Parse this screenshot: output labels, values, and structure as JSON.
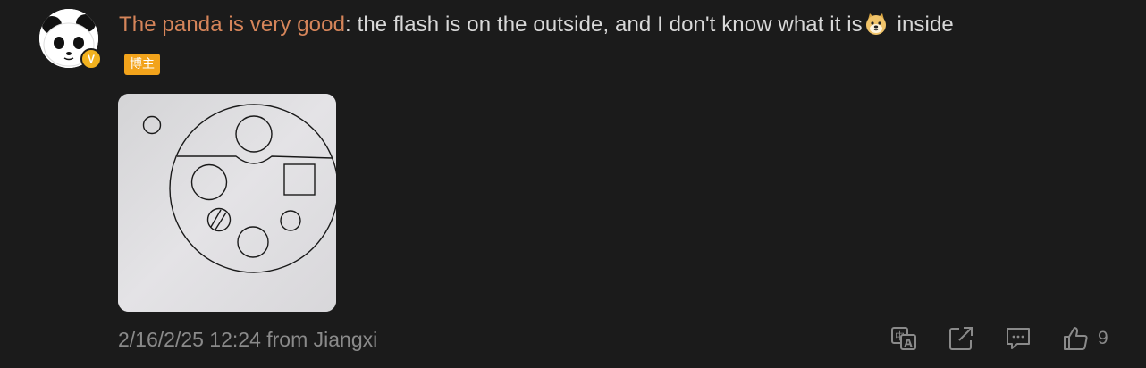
{
  "comment": {
    "username": "The panda is very good",
    "separator": ":",
    "text_before_emoji": " the flash is on the outside, and I don't know what it is",
    "emoji": "doge-emoji",
    "text_after_emoji": " inside",
    "badge": "博主"
  },
  "meta": {
    "timestamp": "2/16/2/25 12:24 from Jiangxi"
  },
  "actions": {
    "translate_icon": "translate-icon",
    "share_icon": "share-icon",
    "reply_icon": "comment-icon",
    "like_icon": "thumbs-up-icon",
    "like_count": "9"
  },
  "colors": {
    "background": "#1b1b1b",
    "username": "#d6855a",
    "text": "#d8d8d8",
    "meta": "#8a8a8a",
    "badge": "#f2a31b",
    "verified": "#f2b21f"
  }
}
